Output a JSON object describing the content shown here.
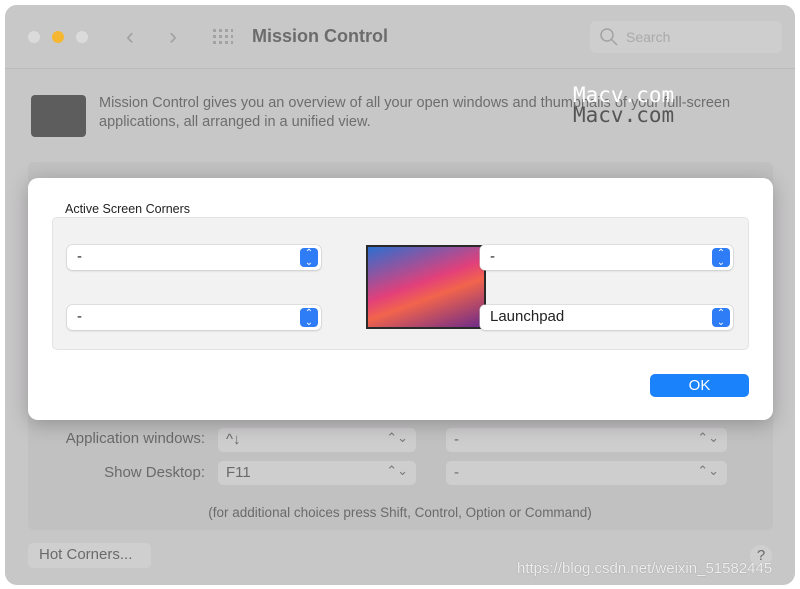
{
  "window": {
    "title": "Mission Control",
    "search_placeholder": "Search"
  },
  "description": "Mission Control gives you an overview of all your open windows and thumbnails of your full-screen applications, all arranged in a unified view.",
  "background": {
    "rows": [
      {
        "label": "Application windows:",
        "value": "^↓",
        "secondary": "-"
      },
      {
        "label": "Show Desktop:",
        "value": "F11",
        "secondary": "-"
      }
    ],
    "note": "(for additional choices press Shift, Control, Option or Command)",
    "hot_corners_label": "Hot Corners...",
    "help_label": "?"
  },
  "sheet": {
    "title": "Active Screen Corners",
    "top_left": "-",
    "bottom_left": "-",
    "top_right": "-",
    "bottom_right": "Launchpad",
    "ok_label": "OK"
  },
  "watermarks": {
    "macv": "Macv.com",
    "csdn": "https://blog.csdn.net/weixin_51582445"
  },
  "colors": {
    "accent": "#1a82fb",
    "minimize": "#f5b731"
  }
}
